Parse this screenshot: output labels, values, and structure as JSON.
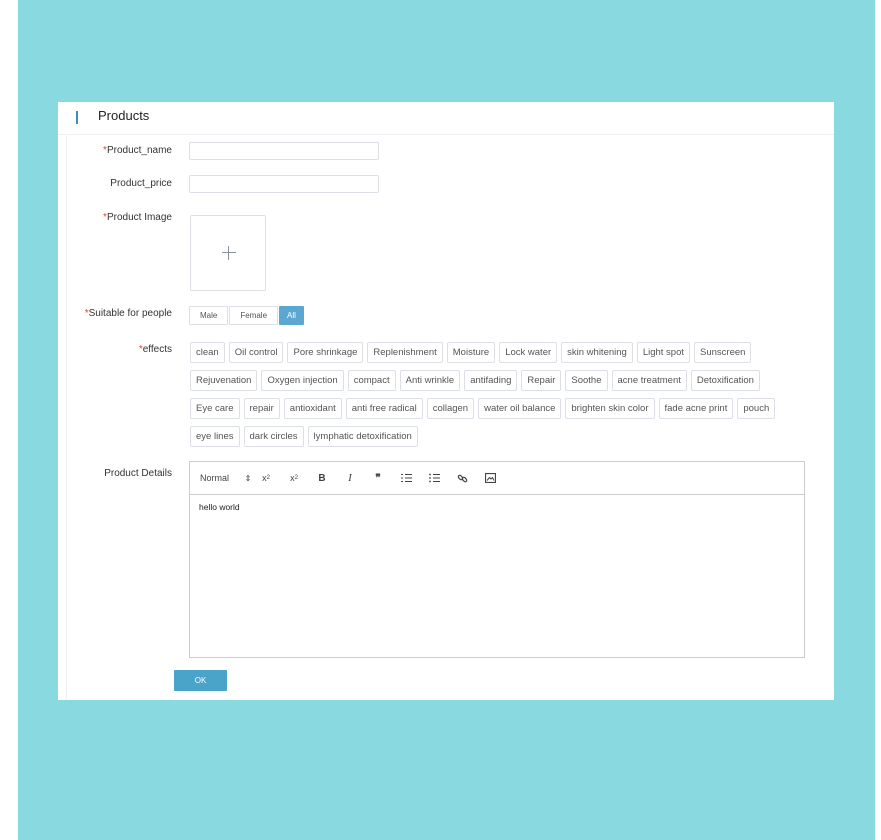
{
  "panel": {
    "title": "Products"
  },
  "form": {
    "product_name": {
      "label": "Product_name",
      "required": "*",
      "value": "",
      "placeholder": ""
    },
    "product_price": {
      "label": "Product_price",
      "value": "",
      "placeholder": ""
    },
    "product_image": {
      "label": "Product Image",
      "required": "*",
      "icon": "plus-icon"
    },
    "suitable": {
      "label": "Suitable for people",
      "required": "*",
      "options": [
        "Male",
        "Female",
        "All"
      ],
      "selected": "All"
    },
    "effects": {
      "label": "effects",
      "required": "*",
      "rows": [
        [
          "clean",
          "Oil control",
          "Pore shrinkage",
          "Replenishment",
          "Moisture",
          "Lock water",
          "skin whitening",
          "Light spot",
          "Sunscreen"
        ],
        [
          "Rejuvenation",
          "Oxygen injection",
          "compact",
          "Anti wrinkle",
          "antifading",
          "Repair",
          "Soothe",
          "acne treatment",
          "Detoxification"
        ],
        [
          "Eye care",
          "repair",
          "antioxidant",
          "anti free radical",
          "collagen",
          "water oil balance",
          "brighten skin color",
          "fade acne print",
          "pouch"
        ],
        [
          "eye lines",
          "dark circles",
          "lymphatic detoxification"
        ]
      ]
    },
    "details": {
      "label": "Product Details",
      "toolbar": {
        "header": "Normal",
        "buttons": [
          "subscript-icon",
          "superscript-icon",
          "bold-icon",
          "italic-icon",
          "blockquote-icon",
          "ordered-list-icon",
          "bullet-list-icon",
          "link-icon",
          "image-icon"
        ]
      },
      "content": "hello world"
    },
    "submit_label": "OK"
  },
  "colors": {
    "background": "#88d9e0",
    "accent": "#4aa3c9",
    "required": "#e0403a"
  }
}
